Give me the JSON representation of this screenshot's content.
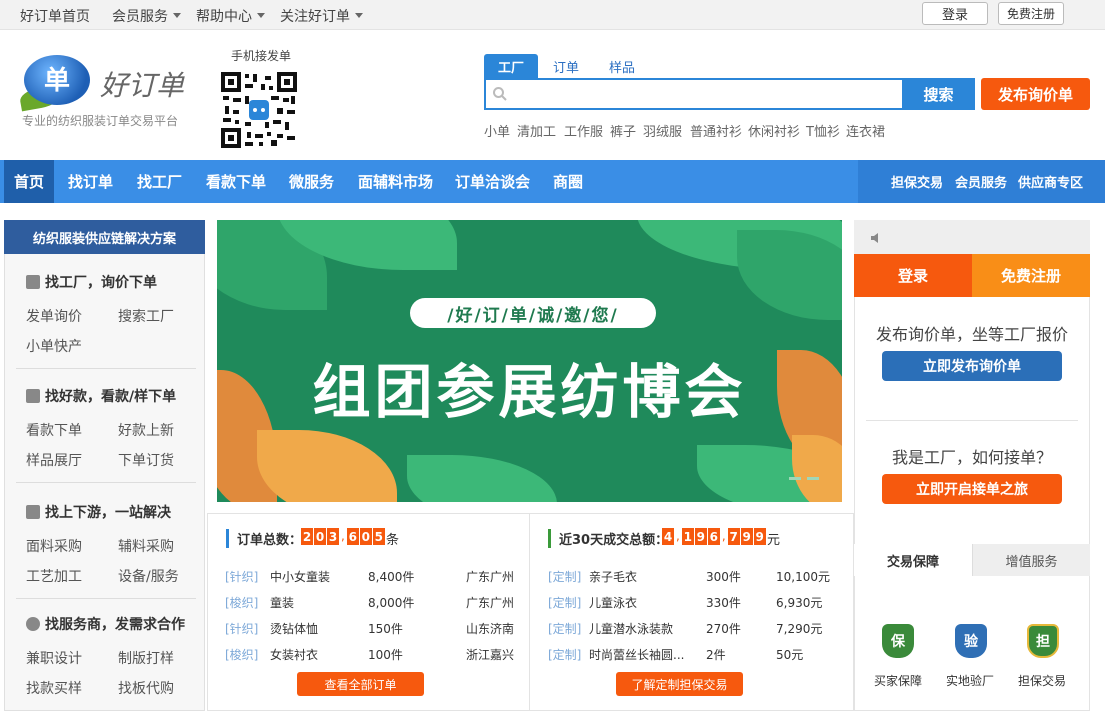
{
  "topbar": {
    "home": "好订单首页",
    "member": "会员服务",
    "help": "帮助中心",
    "follow": "关注好订单",
    "login": "登录",
    "register": "免费注册"
  },
  "header": {
    "logo_char": "单",
    "logo_name": "好订单",
    "slogan": "专业的纺织服装订单交易平台",
    "qr_label": "手机接发单"
  },
  "search": {
    "tabs": [
      "工厂",
      "订单",
      "样品"
    ],
    "placeholder": "",
    "button": "搜索",
    "publish": "发布询价单",
    "hot": [
      "小单",
      "清加工",
      "工作服",
      "裤子",
      "羽绒服",
      "普通衬衫",
      "休闲衬衫",
      "T恤衫",
      "连衣裙"
    ]
  },
  "nav": {
    "items": [
      "首页",
      "找订单",
      "找工厂",
      "看款下单",
      "微服务",
      "面辅料市场",
      "订单洽谈会",
      "商圈"
    ],
    "right": [
      "担保交易",
      "会员服务",
      "供应商专区"
    ]
  },
  "sidebar": {
    "title": "纺织服装供应链解决方案",
    "sections": [
      {
        "title": "找工厂，询价下单",
        "links": [
          "发单询价",
          "搜索工厂",
          "小单快产"
        ]
      },
      {
        "title": "找好款，看款/样下单",
        "links": [
          "看款下单",
          "好款上新",
          "样品展厅",
          "下单订货"
        ]
      },
      {
        "title": "找上下游，一站解决",
        "links": [
          "面料采购",
          "辅料采购",
          "工艺加工",
          "设备/服务"
        ]
      },
      {
        "title": "找服务商，发需求合作",
        "links": [
          "兼职设计",
          "制版打样",
          "找款买样",
          "找板代购"
        ]
      }
    ]
  },
  "banner": {
    "pill": "/好/订/单/诚/邀/您/",
    "headline": "组团参展纺博会"
  },
  "orders": {
    "label": "订单总数：",
    "digits": [
      "2",
      "0",
      "3",
      ",",
      "6",
      "0",
      "5"
    ],
    "unit": "条",
    "rows": [
      {
        "tag": "[针织]",
        "name": "中小女童装",
        "qty": "8,400件",
        "loc": "广东广州"
      },
      {
        "tag": "[梭织]",
        "name": "童装",
        "qty": "8,000件",
        "loc": "广东广州"
      },
      {
        "tag": "[针织]",
        "name": "烫钻体恤",
        "qty": "150件",
        "loc": "山东济南"
      },
      {
        "tag": "[梭织]",
        "name": "女装衬衣",
        "qty": "100件",
        "loc": "浙江嘉兴"
      }
    ],
    "button": "查看全部订单"
  },
  "deals": {
    "label": "近30天成交总额：",
    "digits": [
      "4",
      ",",
      "1",
      "9",
      "6",
      ",",
      "7",
      "9",
      "9"
    ],
    "unit": "元",
    "rows": [
      {
        "tag": "[定制]",
        "name": "亲子毛衣",
        "qty": "300件",
        "amount": "10,100元"
      },
      {
        "tag": "[定制]",
        "name": "儿童泳衣",
        "qty": "330件",
        "amount": "6,930元"
      },
      {
        "tag": "[定制]",
        "name": "儿童潜水泳装款",
        "qty": "270件",
        "amount": "7,290元"
      },
      {
        "tag": "[定制]",
        "name": "时尚蕾丝长袖圆...",
        "qty": "2件",
        "amount": "50元"
      }
    ],
    "button": "了解定制担保交易"
  },
  "right": {
    "login": "登录",
    "register": "免费注册",
    "buyer_text": "发布询价单，坐等工厂报价",
    "buyer_btn": "立即发布询价单",
    "factory_text": "我是工厂，如何接单？",
    "factory_btn": "立即开启接单之旅",
    "tabs": [
      "交易保障",
      "增值服务"
    ],
    "guarantees": [
      {
        "icon": "保",
        "label": "买家保障",
        "color": "#3a8a3a"
      },
      {
        "icon": "验",
        "label": "实地验厂",
        "color": "#2f6fb5"
      },
      {
        "icon": "担",
        "label": "担保交易",
        "color": "#3a8a3a"
      }
    ]
  }
}
